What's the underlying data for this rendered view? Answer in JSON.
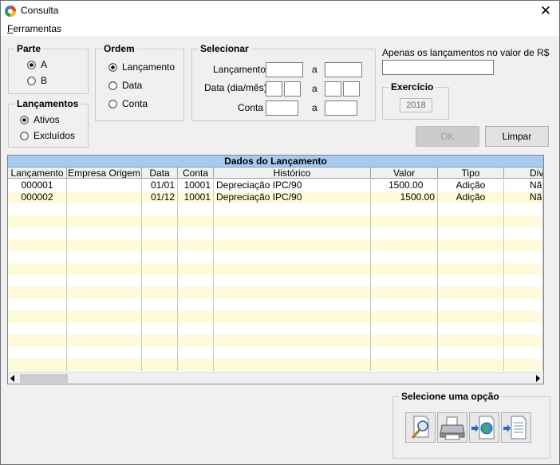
{
  "window": {
    "title": "Consulta",
    "close_glyph": "✕"
  },
  "menu": {
    "ferramentas": "Ferramentas"
  },
  "parte": {
    "legend": "Parte",
    "options": [
      "A",
      "B"
    ],
    "selected": "A"
  },
  "ordem": {
    "legend": "Ordem",
    "options": [
      "Lançamento",
      "Data",
      "Conta"
    ],
    "selected": "Lançamento"
  },
  "lancamentos": {
    "legend": "Lançamentos",
    "options": [
      "Ativos",
      "Excluídos"
    ],
    "selected": "Ativos"
  },
  "selecionar": {
    "legend": "Selecionar",
    "lancamento_label": "Lançamento",
    "data_label": "Data (dia/mês)",
    "conta_label": "Conta",
    "a": "a"
  },
  "valor_filter": {
    "label": "Apenas os lançamentos no valor de R$",
    "value": ""
  },
  "exercicio": {
    "legend": "Exercício",
    "value": "2018"
  },
  "buttons": {
    "ok": "OK",
    "limpar": "Limpar"
  },
  "grid": {
    "caption": "Dados do Lançamento",
    "columns": [
      "Lançamento",
      "Empresa Origem",
      "Data",
      "Conta",
      "Histórico",
      "Valor",
      "Tipo",
      "Div"
    ],
    "rows": [
      {
        "lancamento": "000001",
        "empresa": "",
        "data": "01/01",
        "conta": "10001",
        "historico": "Depreciação IPC/90",
        "valor": "1500.00",
        "tipo": "Adição",
        "div": "Não"
      },
      {
        "lancamento": "000002",
        "empresa": "",
        "data": "01/12",
        "conta": "10001",
        "historico": "Depreciação IPC/90",
        "valor": "1500.00",
        "tipo": "Adição",
        "div": "Não"
      }
    ]
  },
  "opcao": {
    "legend": "Selecione uma opção"
  }
}
